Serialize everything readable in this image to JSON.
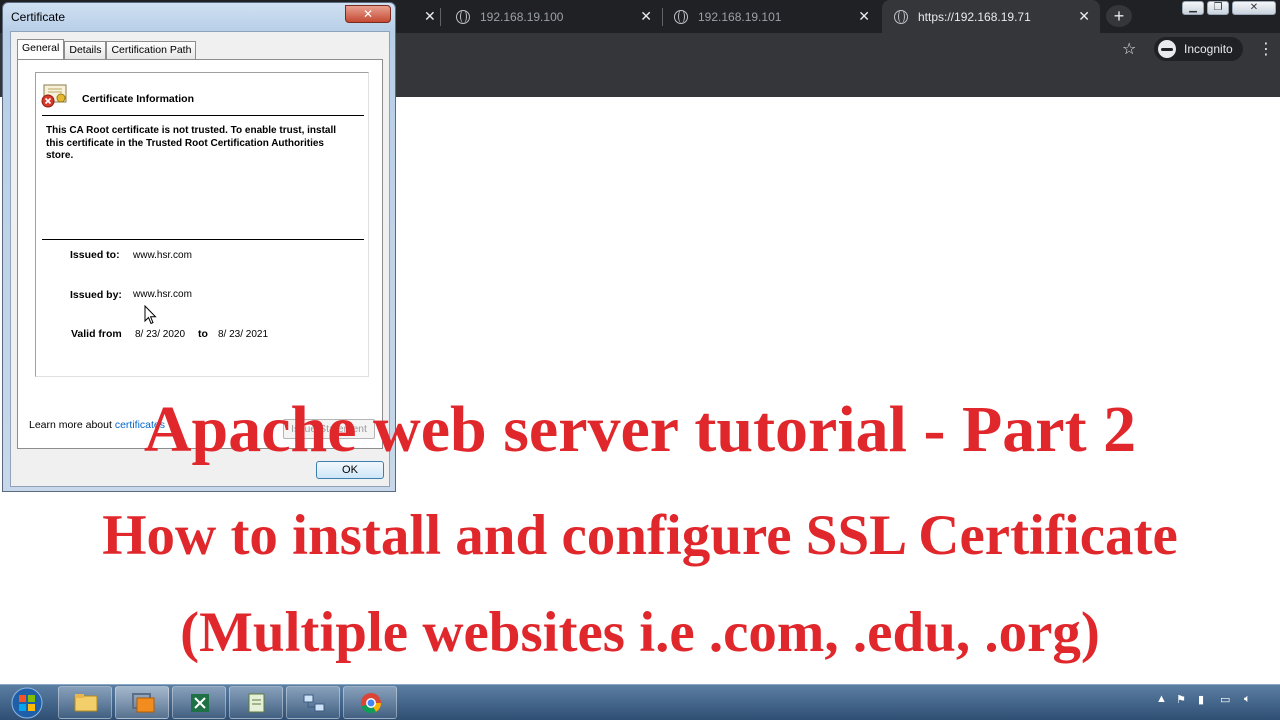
{
  "browser": {
    "tabs": [
      {
        "title": "192.168.19.100"
      },
      {
        "title": "192.168.19.101"
      },
      {
        "title": "https://192.168.19.71"
      }
    ],
    "incognito_label": "Incognito",
    "new_tab_icon": "plus-icon",
    "accent": "#202124"
  },
  "certificate_dialog": {
    "title": "Certificate",
    "tabs": [
      "General",
      "Details",
      "Certification Path"
    ],
    "info_title": "Certificate Information",
    "message": "This CA Root certificate is not trusted. To enable trust, install this certificate in the Trusted Root Certification Authorities store.",
    "issued_to_label": "Issued to:",
    "issued_to_value": "www.hsr.com",
    "issued_by_label": "Issued by:",
    "issued_by_value": "www.hsr.com",
    "valid_from_label": "Valid from",
    "valid_from_value": "8/ 23/ 2020",
    "valid_to_label": "to",
    "valid_to_value": "8/ 23/ 2021",
    "issue_statement_label": "Issue Statement",
    "learn_more_prefix": "Learn more about ",
    "learn_more_link": "certificates",
    "ok_label": "OK"
  },
  "overlay": {
    "line1": "Apache web server tutorial - Part 2",
    "line2": "How to install and configure SSL Certificate",
    "line3": "(Multiple websites i.e .com, .edu, .org)",
    "color": "#e0272c"
  },
  "taskbar": {
    "items": [
      "windows-start-icon",
      "file-explorer-icon",
      "vmware-icon",
      "excel-icon",
      "notepad-icon",
      "network-icon",
      "chrome-icon"
    ]
  }
}
